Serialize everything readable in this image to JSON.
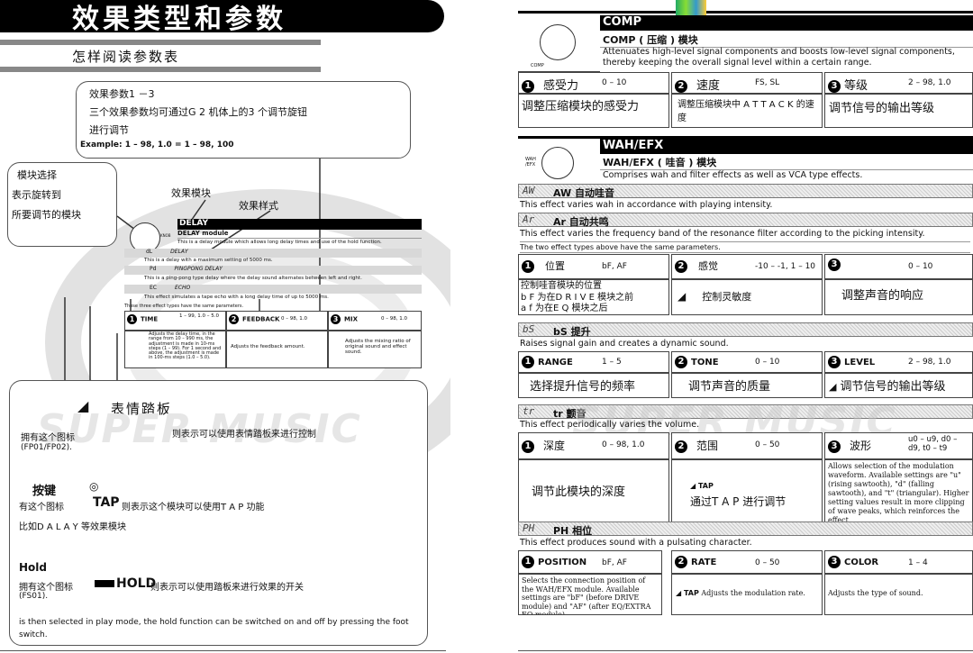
{
  "left": {
    "banner": "效果类型和参数",
    "subtitle": "怎样阅读参数表",
    "callout1": {
      "line1": "效果参数1 －3",
      "line2": "三个效果参数均可通过G 2 机体上的3 个调节旋钮",
      "line3": "进行调节",
      "example": "Example: 1 – 98, 1.0 = 1 – 98, 100"
    },
    "callout2": {
      "line1": "模块选择",
      "line2": "表示旋转到",
      "line3": "所要调节的模块"
    },
    "label_module": "效果模块",
    "label_style": "效果样式",
    "mini": {
      "knob": "KNOB",
      "title": "DELAY",
      "module": "DELAY module",
      "desc": "This is a delay module which allows long delay times and use of the hold function.",
      "r1_code": "dL",
      "r1_name": "DELAY",
      "r1_desc": "This is a delay with a maximum setting of 5000 ms.",
      "r2_code": "Pd",
      "r2_name": "PINGPONG DELAY",
      "r2_desc": "This is a ping-pong type delay where the delay sound alternates between left and right.",
      "r3_code": "EC",
      "r3_name": "ECHO",
      "r3_desc": "This effect simulates a tape echo with a long delay time of up to 5000 ms.",
      "common": "These three effect types have the same parameters.",
      "p1": "TIME",
      "p1v": "1 – 99, 1.0 – 5.0",
      "p2": "FEEDBACK",
      "p2v": "0 – 98, 1.0",
      "p3": "MIX",
      "p3v": "0 – 98, 1.0",
      "p1d": "Adjusts the delay time, in the range from 10 – 990 ms, the adjustment is made in 10-ms steps (1 – 99). For 1 second and above, the adjustment is made in 100-ms steps (1.0 – 5.0).",
      "p2d": "Adjusts the feedback amount.",
      "p3d": "Adjusts the mixing ratio of original sound and effect sound."
    },
    "pedal": {
      "title": "表情踏板",
      "line": "拥有这个图标",
      "right": "则表示可以使用表情踏板来进行控制",
      "code": "(FP01/FP02)."
    },
    "tap": {
      "title": "按键",
      "icon": "◎",
      "line1": "有这个图标",
      "tap": "TAP",
      "line1b": "则表示这个模块可以使用T A P 功能",
      "line2": "比如D A L A Y 等效果模块"
    },
    "hold": {
      "title": "Hold",
      "line1": "拥有这个图标",
      "hold": "HOLD",
      "line1b": "则表示可以使用踏板来进行效果的开关",
      "code": "(FS01).",
      "line2": "is then selected in play mode, the hold function can be switched on and off by pressing the foot switch."
    },
    "watermark": "SUPER MUSIC"
  },
  "right": {
    "comp": {
      "title": "COMP",
      "module": "COMP ( 压缩 ) 模块",
      "desc": "Attenuates high-level signal components and boosts low-level signal components, thereby keeping the overall signal level within a certain range.",
      "knob": "COMP",
      "p1": "感受力",
      "p1v": "0 – 10",
      "p1d": "调整压缩模块的感受力",
      "p2": "速度",
      "p2v": "FS, SL",
      "p2d": "调整压缩模块中 A T T A C K 的速度",
      "p3": "等级",
      "p3v": "2 – 98, 1.0",
      "p3d": "调节信号的输出等级"
    },
    "wah": {
      "title": "WAH/EFX",
      "module": "WAH/EFX ( 哇音 ) 模块",
      "desc": "Comprises wah and filter effects as well as VCA type effects.",
      "knob": "WAH /EFX",
      "aw_code": "AW",
      "aw_name": "AW 自动哇音",
      "aw_desc": "This effect varies wah in accordance with playing intensity.",
      "ar_code": "Ar",
      "ar_name": "Ar 自动共鸣",
      "ar_desc": "This effect varies the frequency band of the resonance filter according to the picking intensity.",
      "common": "The two effect types above have the same parameters.",
      "p1": "位置",
      "p1v": "bF, AF",
      "p1d1": "控制哇音模块的位置",
      "p1d2": "b F 为在D R I V E 模块之前",
      "p1d3": "a f 为在E Q 模块之后",
      "p2": "感觉",
      "p2v": "-10 – -1, 1 – 10",
      "p2d": "控制灵敏度",
      "p3v": "0 – 10",
      "p3d": "调整声音的响应",
      "bs_code": "bS",
      "bs_name": "bS 提升",
      "bs_desc": "Raises signal gain and creates a dynamic sound.",
      "bs1": "RANGE",
      "bs1v": "1 – 5",
      "bs1d": "选择提升信号的频率",
      "bs2": "TONE",
      "bs2v": "0 – 10",
      "bs2d": "调节声音的质量",
      "bs3": "LEVEL",
      "bs3v": "2 – 98, 1.0",
      "bs3d": "调节信号的输出等级",
      "tr_code": "tr",
      "tr_name": "tr 颤音",
      "tr_desc": "This effect periodically varies the volume.",
      "tr1": "深度",
      "tr1v": "0 – 98, 1.0",
      "tr1d": "调节此模块的深度",
      "tr2": "范围",
      "tr2v": "0 – 50",
      "tr2d": "通过T A P 进行调节",
      "tr3": "波形",
      "tr3v": "u0 – u9, d0 – d9, t0 – t9",
      "tr3d": "Allows selection of the modulation waveform. Available settings are \"u\" (rising sawtooth), \"d\" (falling sawtooth), and \"t\" (triangular). Higher setting values result in more clipping of wave peaks, which reinforces the effect.",
      "ph_code": "PH",
      "ph_name": "PH 相位",
      "ph_desc": "This effect produces sound with a pulsating character.",
      "ph1": "POSITION",
      "ph1v": "bF, AF",
      "ph1d": "Selects the connection position of the WAH/EFX module. Available settings are \"bF\" (before DRIVE module) and \"AF\" (after EQ/EXTRA EQ module).",
      "ph2": "RATE",
      "ph2v": "0 – 50",
      "ph2d": "Adjusts the modulation rate.",
      "ph3": "COLOR",
      "ph3v": "1 – 4",
      "ph3d": "Adjusts the type of sound."
    },
    "watermark": "SUPER MUSIC",
    "tap_label": "TAP"
  }
}
